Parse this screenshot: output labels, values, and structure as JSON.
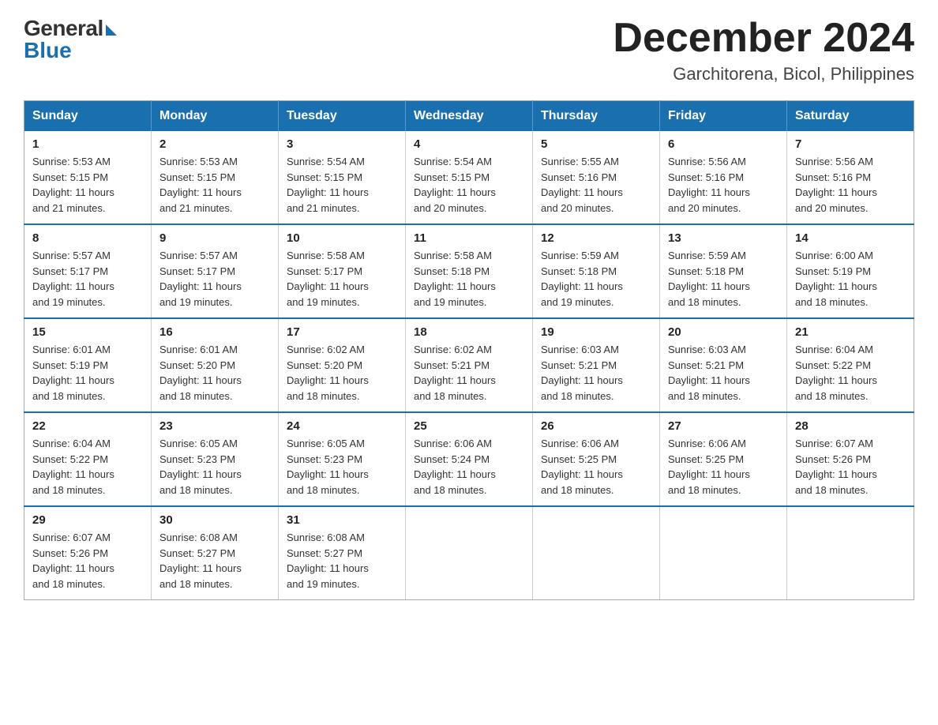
{
  "logo": {
    "general": "General",
    "blue": "Blue"
  },
  "header": {
    "month": "December 2024",
    "location": "Garchitorena, Bicol, Philippines"
  },
  "weekdays": [
    "Sunday",
    "Monday",
    "Tuesday",
    "Wednesday",
    "Thursday",
    "Friday",
    "Saturday"
  ],
  "weeks": [
    [
      {
        "day": "1",
        "sunrise": "5:53 AM",
        "sunset": "5:15 PM",
        "daylight": "11 hours and 21 minutes."
      },
      {
        "day": "2",
        "sunrise": "5:53 AM",
        "sunset": "5:15 PM",
        "daylight": "11 hours and 21 minutes."
      },
      {
        "day": "3",
        "sunrise": "5:54 AM",
        "sunset": "5:15 PM",
        "daylight": "11 hours and 21 minutes."
      },
      {
        "day": "4",
        "sunrise": "5:54 AM",
        "sunset": "5:15 PM",
        "daylight": "11 hours and 20 minutes."
      },
      {
        "day": "5",
        "sunrise": "5:55 AM",
        "sunset": "5:16 PM",
        "daylight": "11 hours and 20 minutes."
      },
      {
        "day": "6",
        "sunrise": "5:56 AM",
        "sunset": "5:16 PM",
        "daylight": "11 hours and 20 minutes."
      },
      {
        "day": "7",
        "sunrise": "5:56 AM",
        "sunset": "5:16 PM",
        "daylight": "11 hours and 20 minutes."
      }
    ],
    [
      {
        "day": "8",
        "sunrise": "5:57 AM",
        "sunset": "5:17 PM",
        "daylight": "11 hours and 19 minutes."
      },
      {
        "day": "9",
        "sunrise": "5:57 AM",
        "sunset": "5:17 PM",
        "daylight": "11 hours and 19 minutes."
      },
      {
        "day": "10",
        "sunrise": "5:58 AM",
        "sunset": "5:17 PM",
        "daylight": "11 hours and 19 minutes."
      },
      {
        "day": "11",
        "sunrise": "5:58 AM",
        "sunset": "5:18 PM",
        "daylight": "11 hours and 19 minutes."
      },
      {
        "day": "12",
        "sunrise": "5:59 AM",
        "sunset": "5:18 PM",
        "daylight": "11 hours and 19 minutes."
      },
      {
        "day": "13",
        "sunrise": "5:59 AM",
        "sunset": "5:18 PM",
        "daylight": "11 hours and 18 minutes."
      },
      {
        "day": "14",
        "sunrise": "6:00 AM",
        "sunset": "5:19 PM",
        "daylight": "11 hours and 18 minutes."
      }
    ],
    [
      {
        "day": "15",
        "sunrise": "6:01 AM",
        "sunset": "5:19 PM",
        "daylight": "11 hours and 18 minutes."
      },
      {
        "day": "16",
        "sunrise": "6:01 AM",
        "sunset": "5:20 PM",
        "daylight": "11 hours and 18 minutes."
      },
      {
        "day": "17",
        "sunrise": "6:02 AM",
        "sunset": "5:20 PM",
        "daylight": "11 hours and 18 minutes."
      },
      {
        "day": "18",
        "sunrise": "6:02 AM",
        "sunset": "5:21 PM",
        "daylight": "11 hours and 18 minutes."
      },
      {
        "day": "19",
        "sunrise": "6:03 AM",
        "sunset": "5:21 PM",
        "daylight": "11 hours and 18 minutes."
      },
      {
        "day": "20",
        "sunrise": "6:03 AM",
        "sunset": "5:21 PM",
        "daylight": "11 hours and 18 minutes."
      },
      {
        "day": "21",
        "sunrise": "6:04 AM",
        "sunset": "5:22 PM",
        "daylight": "11 hours and 18 minutes."
      }
    ],
    [
      {
        "day": "22",
        "sunrise": "6:04 AM",
        "sunset": "5:22 PM",
        "daylight": "11 hours and 18 minutes."
      },
      {
        "day": "23",
        "sunrise": "6:05 AM",
        "sunset": "5:23 PM",
        "daylight": "11 hours and 18 minutes."
      },
      {
        "day": "24",
        "sunrise": "6:05 AM",
        "sunset": "5:23 PM",
        "daylight": "11 hours and 18 minutes."
      },
      {
        "day": "25",
        "sunrise": "6:06 AM",
        "sunset": "5:24 PM",
        "daylight": "11 hours and 18 minutes."
      },
      {
        "day": "26",
        "sunrise": "6:06 AM",
        "sunset": "5:25 PM",
        "daylight": "11 hours and 18 minutes."
      },
      {
        "day": "27",
        "sunrise": "6:06 AM",
        "sunset": "5:25 PM",
        "daylight": "11 hours and 18 minutes."
      },
      {
        "day": "28",
        "sunrise": "6:07 AM",
        "sunset": "5:26 PM",
        "daylight": "11 hours and 18 minutes."
      }
    ],
    [
      {
        "day": "29",
        "sunrise": "6:07 AM",
        "sunset": "5:26 PM",
        "daylight": "11 hours and 18 minutes."
      },
      {
        "day": "30",
        "sunrise": "6:08 AM",
        "sunset": "5:27 PM",
        "daylight": "11 hours and 18 minutes."
      },
      {
        "day": "31",
        "sunrise": "6:08 AM",
        "sunset": "5:27 PM",
        "daylight": "11 hours and 19 minutes."
      },
      null,
      null,
      null,
      null
    ]
  ],
  "labels": {
    "sunrise": "Sunrise:",
    "sunset": "Sunset:",
    "daylight": "Daylight:"
  }
}
